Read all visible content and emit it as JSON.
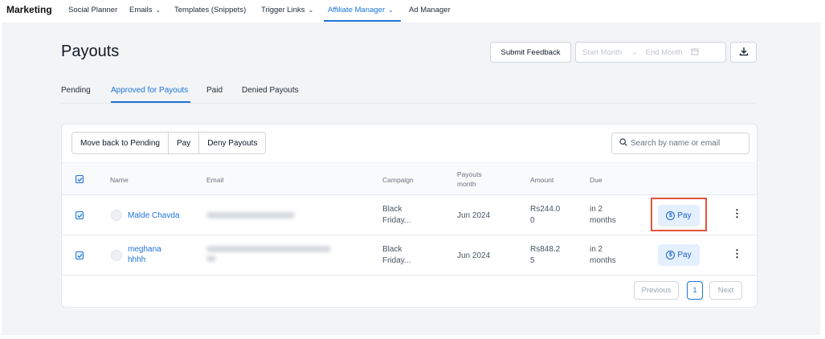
{
  "nav": {
    "brand": "Marketing",
    "items": [
      {
        "label": "Social Planner",
        "has_chevron": false,
        "active": false
      },
      {
        "label": "Emails",
        "has_chevron": true,
        "active": false
      },
      {
        "label": "Templates (Snippets)",
        "has_chevron": false,
        "active": false
      },
      {
        "label": "Trigger Links",
        "has_chevron": true,
        "active": false
      },
      {
        "label": "Affiliate Manager",
        "has_chevron": true,
        "active": true
      },
      {
        "label": "Ad Manager",
        "has_chevron": false,
        "active": false
      }
    ]
  },
  "header": {
    "title": "Payouts",
    "feedback_label": "Submit Feedback",
    "start_placeholder": "Start Month",
    "end_placeholder": "End Month",
    "download_icon": "download-icon"
  },
  "tabs": [
    {
      "label": "Pending",
      "active": false
    },
    {
      "label": "Approved for Payouts",
      "active": true
    },
    {
      "label": "Paid",
      "active": false
    },
    {
      "label": "Denied Payouts",
      "active": false
    }
  ],
  "actions": {
    "move_back": "Move back to Pending",
    "pay": "Pay",
    "deny": "Deny Payouts"
  },
  "search": {
    "placeholder": "Search by name or email"
  },
  "table": {
    "columns": {
      "name": "Name",
      "email": "Email",
      "campaign": "Campaign",
      "payouts_month_1": "Payouts",
      "payouts_month_2": "month",
      "amount": "Amount",
      "due": "Due"
    },
    "rows": [
      {
        "checked": true,
        "name_line1": "Malde Chavda",
        "name_line2": "",
        "campaign_line1": "Black",
        "campaign_line2": "Friday...",
        "month": "Jun 2024",
        "amount_line1": "Rs244.0",
        "amount_line2": "0",
        "due_line1": "in 2",
        "due_line2": "months",
        "pay_label": "Pay"
      },
      {
        "checked": true,
        "name_line1": "meghana",
        "name_line2": "hhhh",
        "campaign_line1": "Black",
        "campaign_line2": "Friday...",
        "month": "Jun 2024",
        "amount_line1": "Rs848.2",
        "amount_line2": "5",
        "due_line1": "in 2",
        "due_line2": "months",
        "pay_label": "Pay"
      }
    ]
  },
  "pagination": {
    "previous": "Previous",
    "current": "1",
    "next": "Next"
  },
  "colors": {
    "accent": "#1d74d8",
    "highlight": "#e5533c",
    "pay_bg": "#e4efff"
  }
}
